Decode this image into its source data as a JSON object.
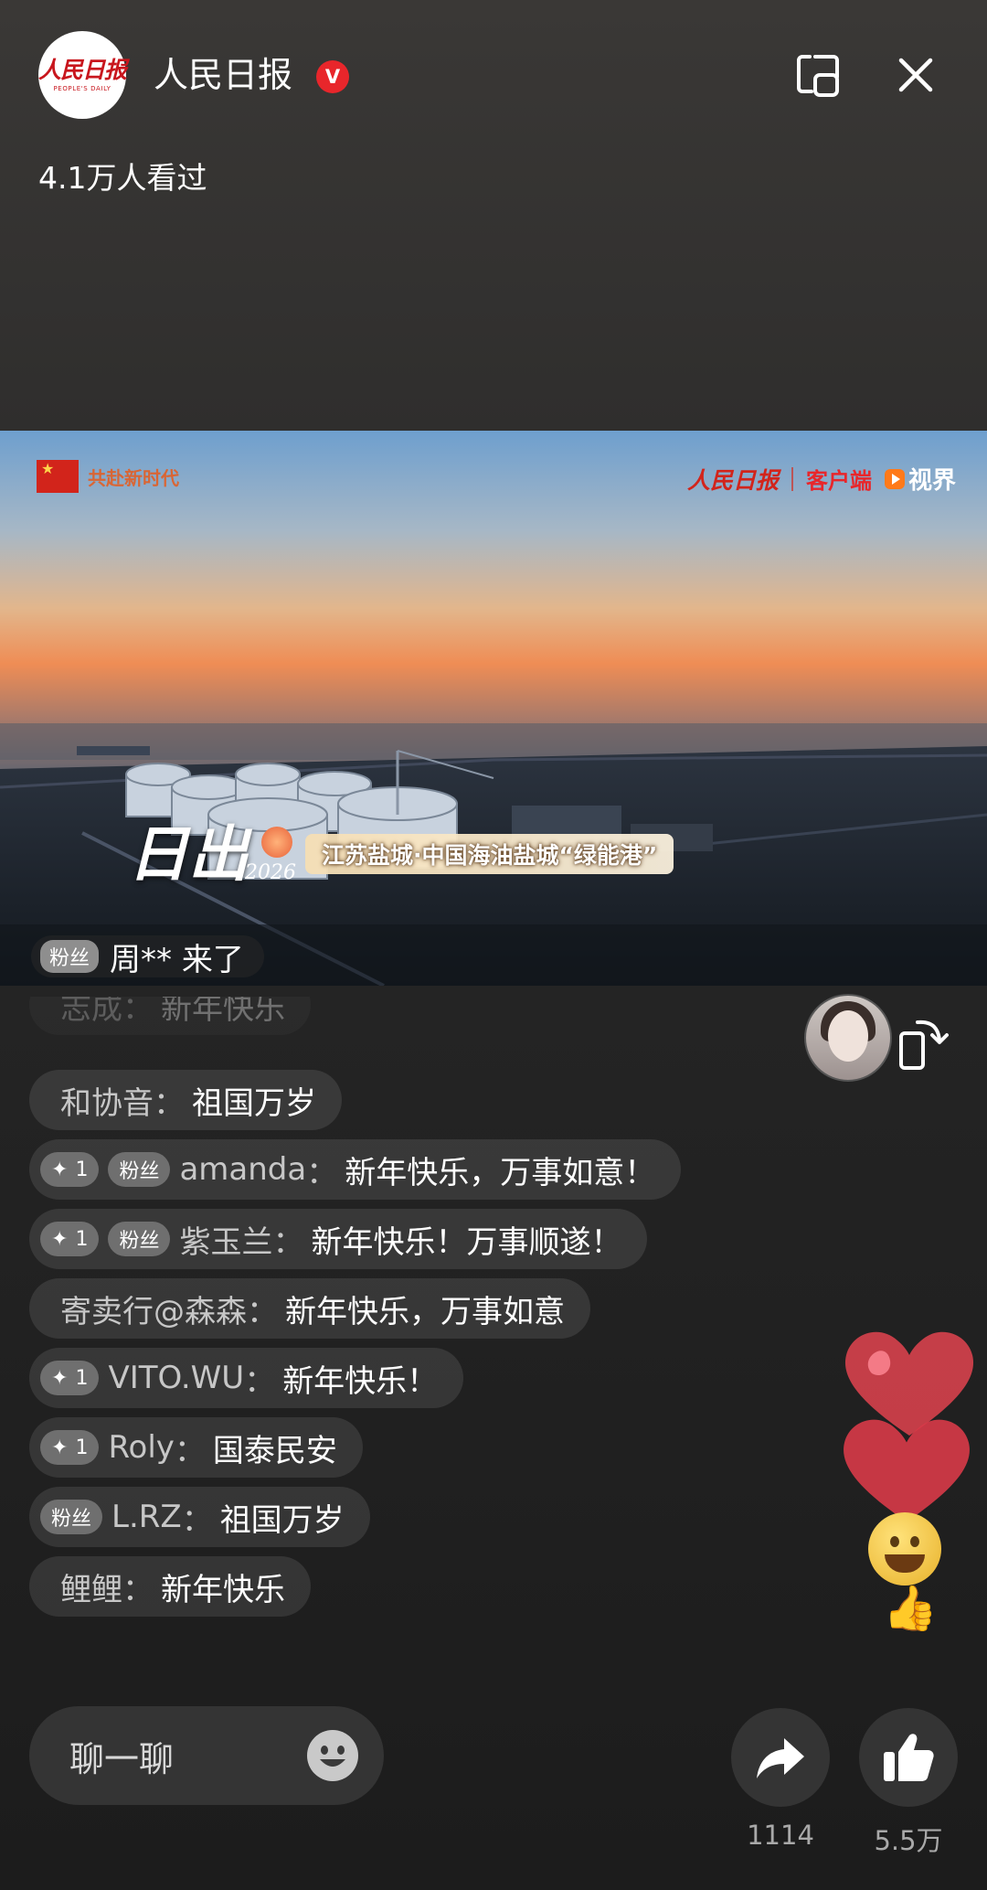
{
  "header": {
    "channel_name": "人民日报",
    "verified_badge": "V",
    "logo_text": "人民日报",
    "logo_sub": "PEOPLE'S DAILY",
    "viewers": "4.1万人看过"
  },
  "video": {
    "watermark_left": "共赴新时代",
    "watermark_paper": "人民日报",
    "watermark_client": "客户端",
    "watermark_shijie": "视界",
    "caption_big": "日出",
    "caption_year": "2026",
    "caption_banner": "江苏盐城·中国海油盐城“绿能港”",
    "entry_badge": "粉丝",
    "entry_text": "周** 来了"
  },
  "comments": [
    {
      "user": "志成",
      "text": "新年快乐",
      "badges": [],
      "faded": true
    },
    {
      "user": "和协音",
      "text": "祖国万岁",
      "badges": []
    },
    {
      "user": "amanda",
      "text": "新年快乐，万事如意！",
      "badges": [
        {
          "icon": "sparkle-icon",
          "label": "1"
        },
        {
          "label": "粉丝"
        }
      ]
    },
    {
      "user": "紫玉兰",
      "text": "新年快乐！万事顺遂！",
      "badges": [
        {
          "icon": "sparkle-icon",
          "label": "1"
        },
        {
          "label": "粉丝"
        }
      ]
    },
    {
      "user": "寄卖行@森森",
      "text": "新年快乐，万事如意",
      "badges": []
    },
    {
      "user": "VITO.WU",
      "text": "新年快乐！",
      "badges": [
        {
          "icon": "sparkle-icon",
          "label": "1"
        }
      ]
    },
    {
      "user": "Roly",
      "text": "国泰民安",
      "badges": [
        {
          "icon": "sparkle-icon",
          "label": "1"
        }
      ]
    },
    {
      "user": "L.RZ",
      "text": "祖国万岁",
      "badges": [
        {
          "label": "粉丝"
        }
      ]
    },
    {
      "user": "鲤鲤",
      "text": "新年快乐",
      "badges": []
    }
  ],
  "bottom_bar": {
    "chat_placeholder": "聊一聊",
    "share_count": "1114",
    "like_count": "5.5万"
  },
  "icons": {
    "pip": "picture-in-picture-icon",
    "close": "close-icon",
    "rotate": "rotate-screen-icon",
    "emoji": "emoji-icon",
    "share": "share-arrow-icon",
    "like": "thumbs-up-icon"
  },
  "colors": {
    "brand_red": "#e8262b",
    "comment_bubble": "rgba(255,255,255,0.1)",
    "badge_gray": "#6f6f6f"
  }
}
